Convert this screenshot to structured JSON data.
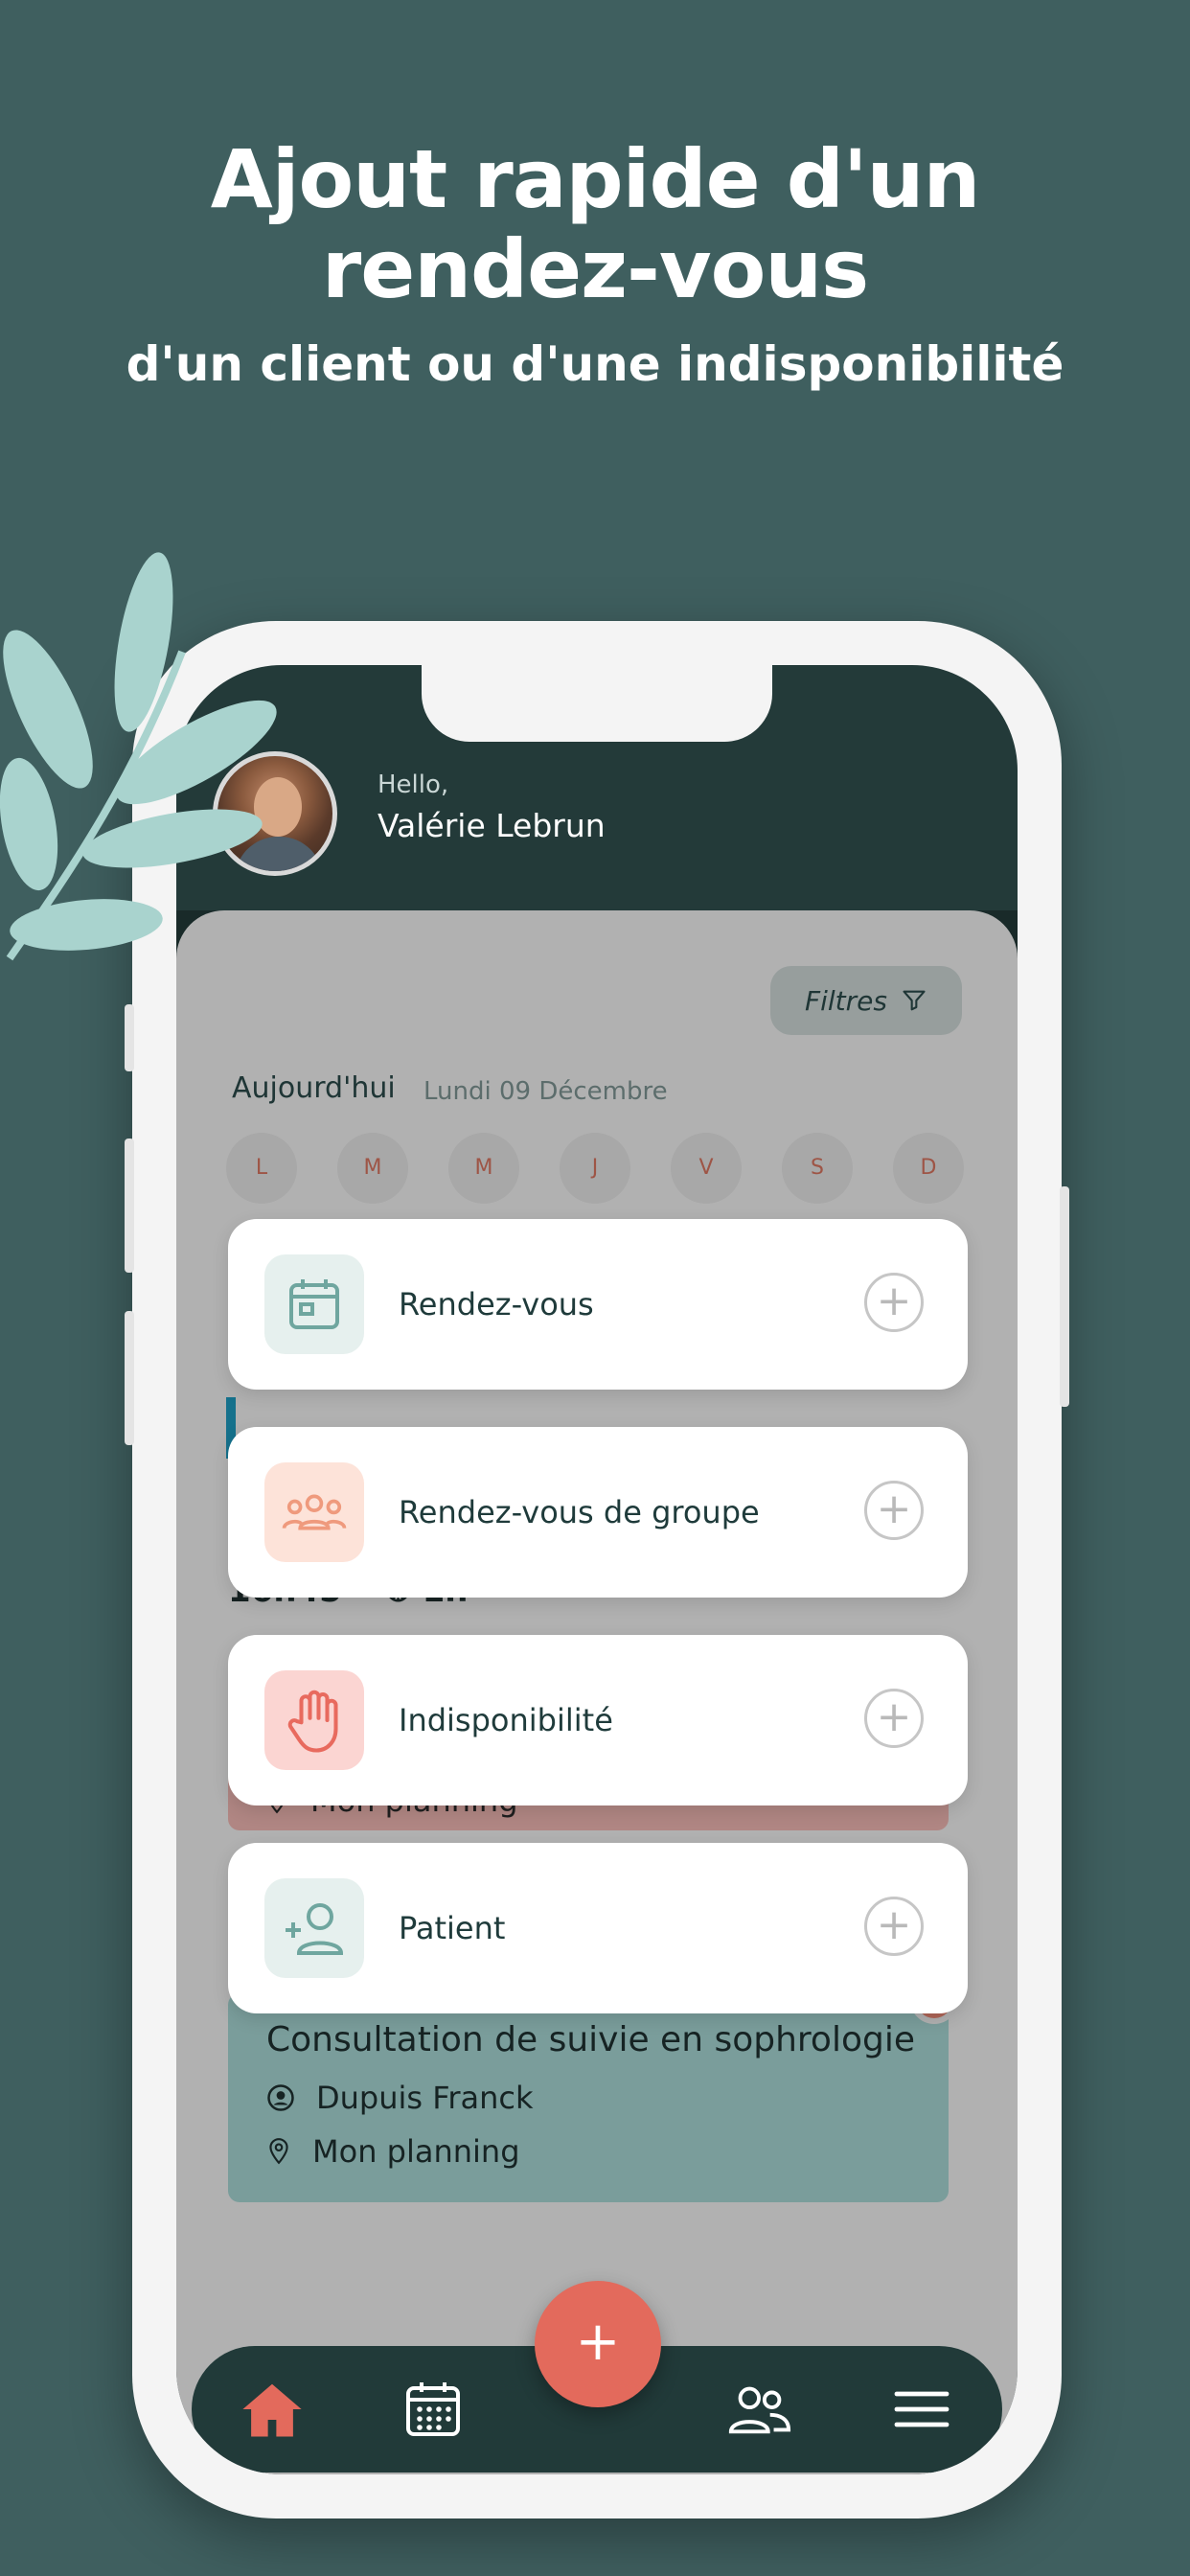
{
  "headline": {
    "title_line1": "Ajout rapide d'un",
    "title_line2": "rendez-vous",
    "subtitle": "d'un client ou d'une indisponibilité"
  },
  "header": {
    "greeting": "Hello,",
    "user_name": "Valérie Lebrun"
  },
  "toolbar": {
    "filters_label": "Filtres"
  },
  "calendar": {
    "today_label": "Aujourd'hui",
    "date_label": "Lundi 09 Décembre",
    "day_initials": [
      "L",
      "M",
      "M",
      "J",
      "V",
      "S",
      "D"
    ]
  },
  "schedule": {
    "time_fragment": "16h45 • ⏱ 1h",
    "events": [
      {
        "location": "Mon planning"
      },
      {
        "title": "Consultation de suivie en sophrologie",
        "client": "Dupuis Franck",
        "location": "Mon planning"
      }
    ]
  },
  "quick_add": {
    "items": [
      {
        "label": "Rendez-vous",
        "icon": "calendar-icon"
      },
      {
        "label": "Rendez-vous de groupe",
        "icon": "group-icon"
      },
      {
        "label": "Indisponibilité",
        "icon": "hand-stop-icon"
      },
      {
        "label": "Patient",
        "icon": "add-user-icon"
      }
    ],
    "plus_symbol": "+"
  },
  "fab": {
    "symbol": "+"
  },
  "nav": {
    "items": [
      "home-icon",
      "calendar-grid-icon",
      "users-icon",
      "menu-icon"
    ]
  },
  "colors": {
    "background": "#3f5f5f",
    "header_dark": "#233a39",
    "accent_red": "#e36a5c",
    "event_green": "#a8d7d5",
    "event_red": "#f1b8b4",
    "leaf": "#a9d3ce"
  }
}
